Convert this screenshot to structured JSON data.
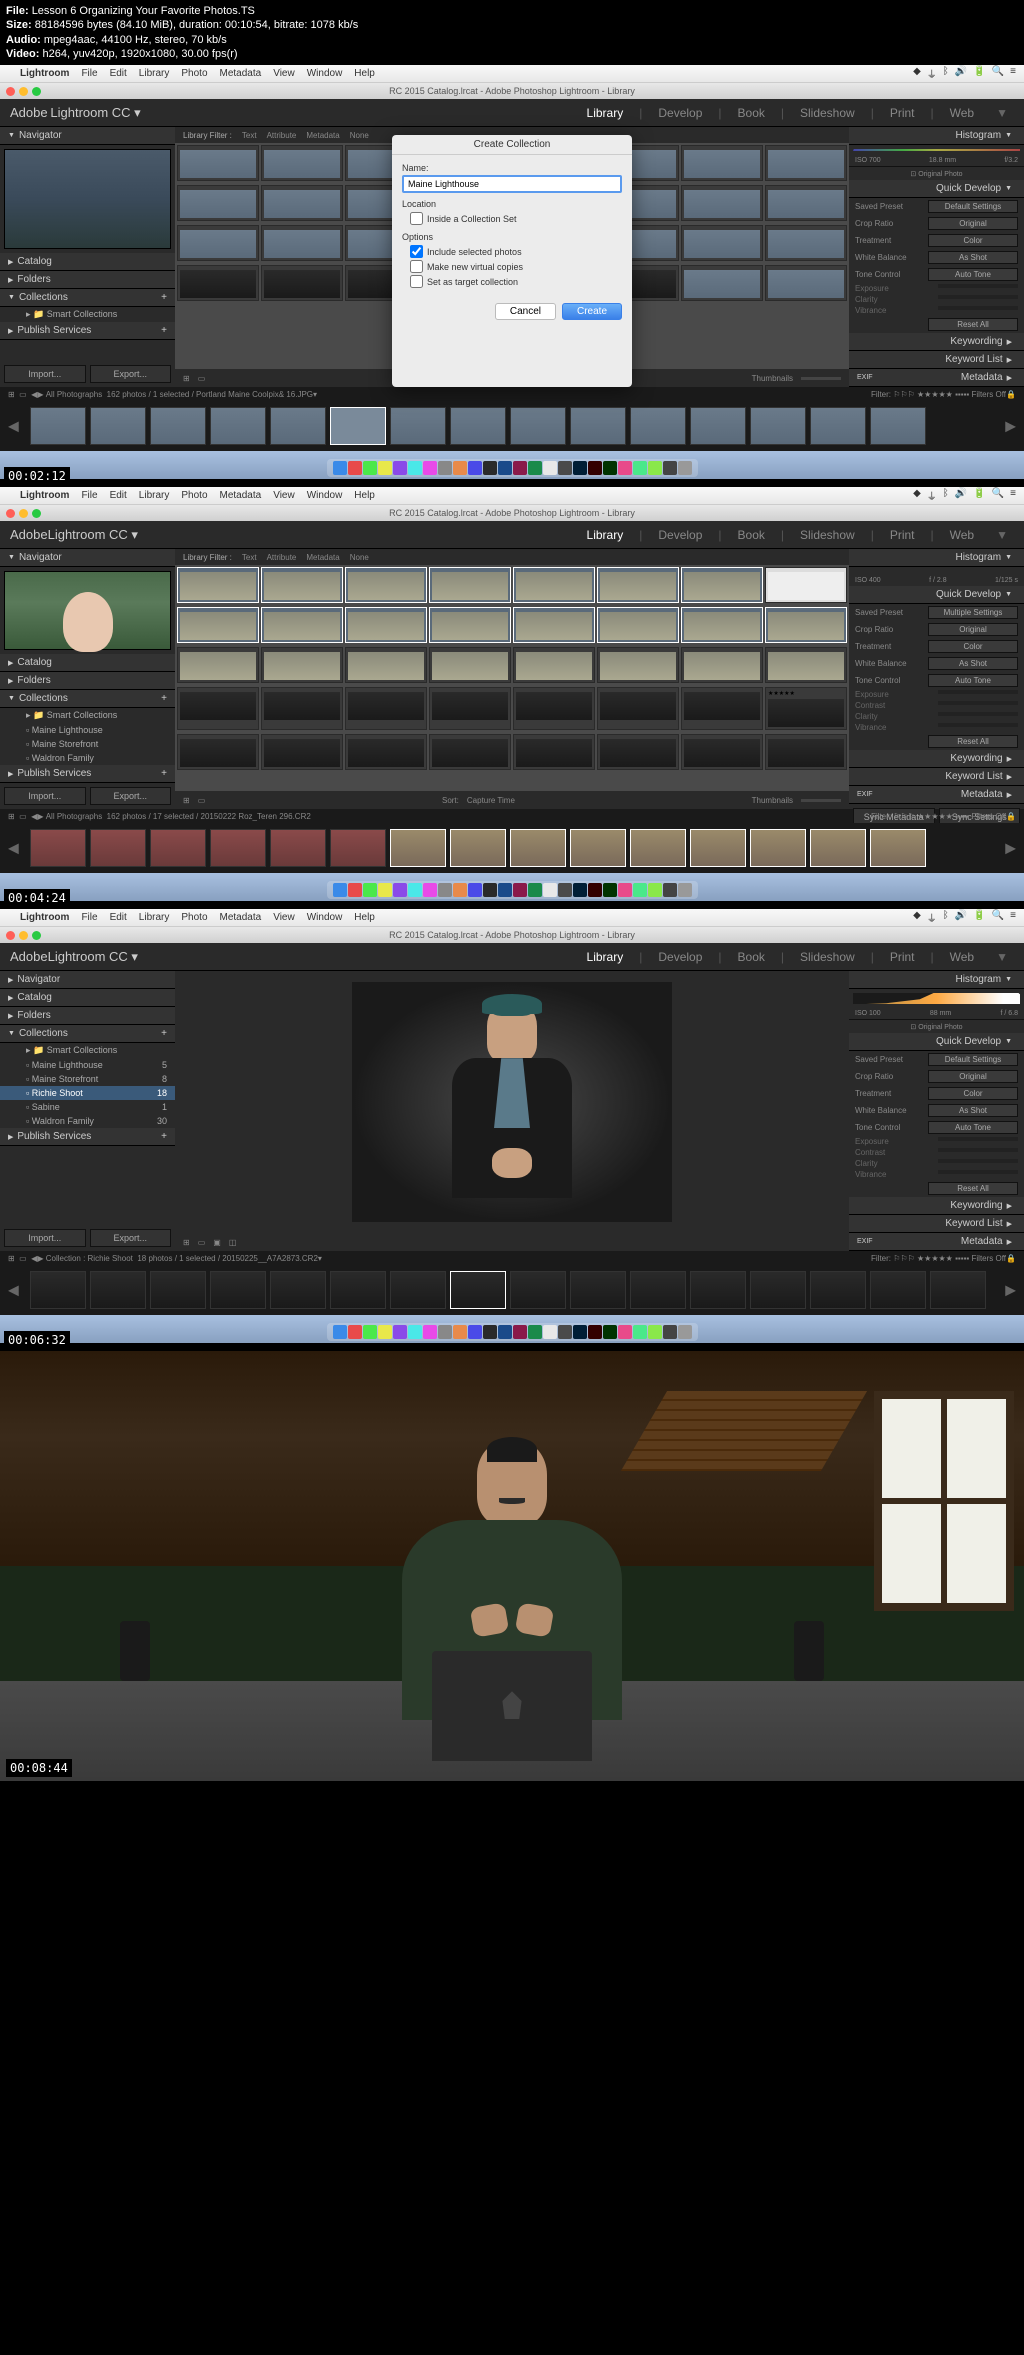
{
  "header": {
    "file_label": "File:",
    "file": "Lesson 6 Organizing Your Favorite Photos.TS",
    "size_label": "Size:",
    "size": "88184596 bytes (84.10 MiB), duration: 00:10:54, bitrate: 1078 kb/s",
    "audio_label": "Audio:",
    "audio": "mpeg4aac, 44100 Hz, stereo, 70 kb/s",
    "video_label": "Video:",
    "video": "h264, yuv420p, 1920x1080, 30.00 fps(r)"
  },
  "timestamps": {
    "t1": "00:02:12",
    "t2": "00:04:24",
    "t3": "00:06:32",
    "t4": "00:08:44"
  },
  "mac_menu": {
    "app": "Lightroom",
    "items": [
      "File",
      "Edit",
      "Library",
      "Photo",
      "Metadata",
      "View",
      "Window",
      "Help"
    ]
  },
  "window_title": "RC 2015 Catalog.lrcat - Adobe Photoshop Lightroom - Library",
  "lr": {
    "brand_top": "Adobe",
    "brand": "Lightroom CC ▾",
    "modules": [
      "Library",
      "Develop",
      "Book",
      "Slideshow",
      "Print",
      "Web"
    ]
  },
  "left_panel": {
    "navigator": "Navigator",
    "catalog": "Catalog",
    "folders": "Folders",
    "collections": "Collections",
    "publish": "Publish Services",
    "smart_collections": "Smart Collections",
    "import_btn": "Import...",
    "export_btn": "Export..."
  },
  "right_panel": {
    "histogram": "Histogram",
    "original_photo": "Original Photo",
    "quick_develop": "Quick Develop",
    "saved_preset": "Saved Preset",
    "default_settings": "Default Settings",
    "crop_ratio": "Crop Ratio",
    "original": "Original",
    "treatment": "Treatment",
    "color": "Color",
    "white_balance": "White Balance",
    "as_shot": "As Shot",
    "tone_control": "Tone Control",
    "auto_tone": "Auto Tone",
    "exposure": "Exposure",
    "contrast": "Contrast",
    "clarity": "Clarity",
    "vibrance": "Vibrance",
    "reset_all": "Reset All",
    "keywording": "Keywording",
    "keyword_list": "Keyword List",
    "metadata": "Metadata",
    "sync_metadata": "Sync Metadata",
    "sync_settings": "Sync Settings",
    "histo1": {
      "iso": "ISO 700",
      "fl": "18.8 mm",
      "f": "f/3.2"
    },
    "histo2": {
      "iso": "ISO 400",
      "fl": "",
      "f": "f / 2.8",
      "s": "1/125 s"
    },
    "histo3": {
      "iso": "ISO 100",
      "fl": "88 mm",
      "f": "f / 6.8"
    }
  },
  "filter_bar": {
    "title": "Library Filter :",
    "text": "Text",
    "attribute": "Attribute",
    "metintroduction": "Metadata",
    "none": "None"
  },
  "toolbar": {
    "sort": "Sort:",
    "capture_time": "Capture Time",
    "thumbnails": "Thumbnails"
  },
  "filmstrip_bar1": {
    "path": "All Photographs",
    "count": "162 photos / 1 selected / Portland Maine Coolpix& 16.JPG▾",
    "filter": "Filter:",
    "filters_off": "Filters Off"
  },
  "filmstrip_bar2": {
    "path": "All Photographs",
    "count": "162 photos / 17 selected / 20150222 Roz_Teren 296.CR2",
    "filter": "Filter:",
    "filters_off": "Filters Off"
  },
  "filmstrip_bar3": {
    "path": "Collection : Richie Shoot",
    "count": "18 photos / 1 selected / 20150225__A7A2873.CR2▾",
    "filter": "Filter:",
    "filters_off": "Filters Off"
  },
  "dialog": {
    "title": "Create Collection",
    "name_label": "Name:",
    "name_value": "Maine Lighthouse",
    "location_label": "Location",
    "inside_set": "Inside a Collection Set",
    "options_label": "Options",
    "include_selected": "Include selected photos",
    "make_virtual": "Make new virtual copies",
    "set_target": "Set as target collection",
    "cancel": "Cancel",
    "create": "Create"
  },
  "collections_frame2": {
    "items": [
      {
        "name": "Smart Collections",
        "count": ""
      },
      {
        "name": "Maine Lighthouse",
        "count": ""
      },
      {
        "name": "Maine Storefront",
        "count": ""
      },
      {
        "name": "Waldron Family",
        "count": ""
      }
    ]
  },
  "collections_frame3": {
    "items": [
      {
        "name": "Smart Collections",
        "count": ""
      },
      {
        "name": "Maine Lighthouse",
        "count": "5"
      },
      {
        "name": "Maine Storefront",
        "count": "8"
      },
      {
        "name": "Richie Shoot",
        "count": "18"
      },
      {
        "name": "Sabine",
        "count": "1"
      },
      {
        "name": "Waldron Family",
        "count": "30"
      }
    ]
  },
  "exif_label": "EXIF"
}
